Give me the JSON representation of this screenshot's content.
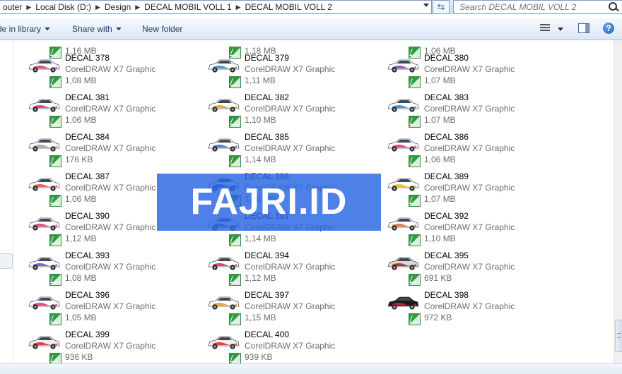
{
  "address": {
    "crumbs": [
      "outer",
      "Local Disk (D:)",
      "Design",
      "DECAL MOBIL VOLL 1",
      "DECAL MOBIL VOLL 2"
    ]
  },
  "search": {
    "placeholder": "Search DECAL MOBIL VOLL 2"
  },
  "toolbar": {
    "include_label": "de in library",
    "share_label": "Share with",
    "new_folder_label": "New folder",
    "help_glyph": "?"
  },
  "files": {
    "partial_sizes": [
      "1,16 MB",
      "1,18 MB",
      "1,06 MB"
    ],
    "items": [
      {
        "name": "DECAL 378",
        "type": "CorelDRAW X7 Graphic",
        "size": "1,08 MB"
      },
      {
        "name": "DECAL 379",
        "type": "CorelDRAW X7 Graphic",
        "size": "1,11 MB"
      },
      {
        "name": "DECAL 380",
        "type": "CorelDRAW X7 Graphic",
        "size": "1,07 MB"
      },
      {
        "name": "DECAL 381",
        "type": "CorelDRAW X7 Graphic",
        "size": "1,06 MB"
      },
      {
        "name": "DECAL 382",
        "type": "CorelDRAW X7 Graphic",
        "size": "1,10 MB"
      },
      {
        "name": "DECAL 383",
        "type": "CorelDRAW X7 Graphic",
        "size": "1,07 MB"
      },
      {
        "name": "DECAL 384",
        "type": "CorelDRAW X7 Graphic",
        "size": "176 KB"
      },
      {
        "name": "DECAL 385",
        "type": "CorelDRAW X7 Graphic",
        "size": "1,14 MB"
      },
      {
        "name": "DECAL 386",
        "type": "CorelDRAW X7 Graphic",
        "size": "1,06 MB"
      },
      {
        "name": "DECAL 387",
        "type": "CorelDRAW X7 Graphic",
        "size": "1,06 MB"
      },
      {
        "name": "DECAL 388",
        "type": "CorelDRAW X7 Graphic",
        "size": "1,18 MB"
      },
      {
        "name": "DECAL 389",
        "type": "CorelDRAW X7 Graphic",
        "size": "1,07 MB"
      },
      {
        "name": "DECAL 390",
        "type": "CorelDRAW X7 Graphic",
        "size": "1,12 MB"
      },
      {
        "name": "DECAL 391",
        "type": "CorelDRAW X7 Graphic",
        "size": "1,14 MB"
      },
      {
        "name": "DECAL 392",
        "type": "CorelDRAW X7 Graphic",
        "size": "1,10 MB"
      },
      {
        "name": "DECAL 393",
        "type": "CorelDRAW X7 Graphic",
        "size": "1,08 MB"
      },
      {
        "name": "DECAL 394",
        "type": "CorelDRAW X7 Graphic",
        "size": "1,12 MB"
      },
      {
        "name": "DECAL 395",
        "type": "CorelDRAW X7 Graphic",
        "size": "691 KB"
      },
      {
        "name": "DECAL 396",
        "type": "CorelDRAW X7 Graphic",
        "size": "1,05 MB"
      },
      {
        "name": "DECAL 397",
        "type": "CorelDRAW X7 Graphic",
        "size": "1,15 MB"
      },
      {
        "name": "DECAL 398",
        "type": "CorelDRAW X7 Graphic",
        "size": "972 KB"
      },
      {
        "name": "DECAL 399",
        "type": "CorelDRAW X7 Graphic",
        "size": "936 KB"
      },
      {
        "name": "DECAL 400",
        "type": "CorelDRAW X7 Graphic",
        "size": "939 KB"
      }
    ],
    "decal_colors": [
      "#e0357a",
      "#2d8fe0",
      "#8a3fd1",
      "#e0357a",
      "#f0a020",
      "#2d8fe0",
      "#9aa3ad",
      "#3b6fd9",
      "#e0357a",
      "#e05050",
      "#3050c0",
      "#f0c020",
      "#e0357a",
      "#3050c0",
      "#e07030",
      "#7a50d0",
      "#e03050",
      "#c02020",
      "#e0357a",
      "#f0a020",
      "#d02040",
      "#e03030",
      "#e03030"
    ],
    "body_colors": [
      "#ffffff",
      "#ffffff",
      "#ffffff",
      "#ffffff",
      "#ffffff",
      "#ffffff",
      "#ffffff",
      "#ffffff",
      "#ffffff",
      "#ffffff",
      "#ffffff",
      "#ffffff",
      "#ffffff",
      "#ffffff",
      "#ffffff",
      "#ffffff",
      "#ffffff",
      "#d8d8d8",
      "#ffffff",
      "#ffffff",
      "#1a1a1a",
      "#f0f0f0",
      "#f0f0f0"
    ]
  },
  "watermark": {
    "text": "FAJRI.ID"
  }
}
